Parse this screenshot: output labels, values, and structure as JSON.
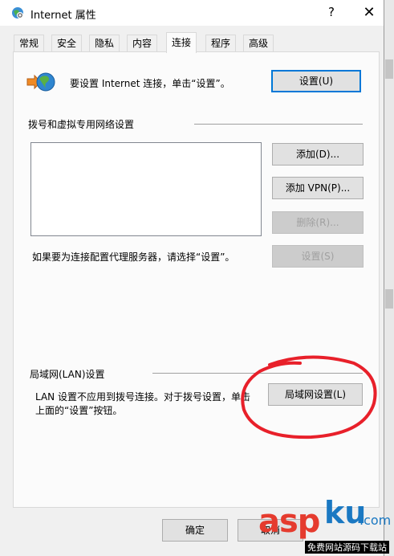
{
  "window": {
    "title": "Internet 属性",
    "help_glyph": "?",
    "close_glyph": "✕"
  },
  "tabs": [
    {
      "label": "常规"
    },
    {
      "label": "安全"
    },
    {
      "label": "隐私"
    },
    {
      "label": "内容"
    },
    {
      "label": "连接",
      "active": true
    },
    {
      "label": "程序"
    },
    {
      "label": "高级"
    }
  ],
  "setup": {
    "text": "要设置 Internet 连接，单击“设置”。",
    "button": "设置(U)"
  },
  "dialup": {
    "group_label": "拨号和虚拟专用网络设置",
    "buttons": {
      "add": "添加(D)...",
      "add_vpn": "添加 VPN(P)...",
      "remove": "删除(R)...",
      "settings": "设置(S)"
    },
    "proxy_hint": "如果要为连接配置代理服务器，请选择“设置”。"
  },
  "lan": {
    "group_label": "局域网(LAN)设置",
    "text_line1": "LAN 设置不应用到拨号连接。对于拨号设置，单击",
    "text_line2": "上面的“设置”按钮。",
    "button": "局域网设置(L)"
  },
  "footer": {
    "ok": "确定",
    "cancel": "取消"
  },
  "watermark": {
    "brand_asp": "asp",
    "brand_ku": "ku",
    "brand_com": ".com",
    "sub": "免费网站源码下载站"
  },
  "colors": {
    "focus_border": "#0078d7",
    "annotation_circle": "#e8202a",
    "watermark_red": "#e53b2e",
    "watermark_blue": "#1a78c2"
  }
}
